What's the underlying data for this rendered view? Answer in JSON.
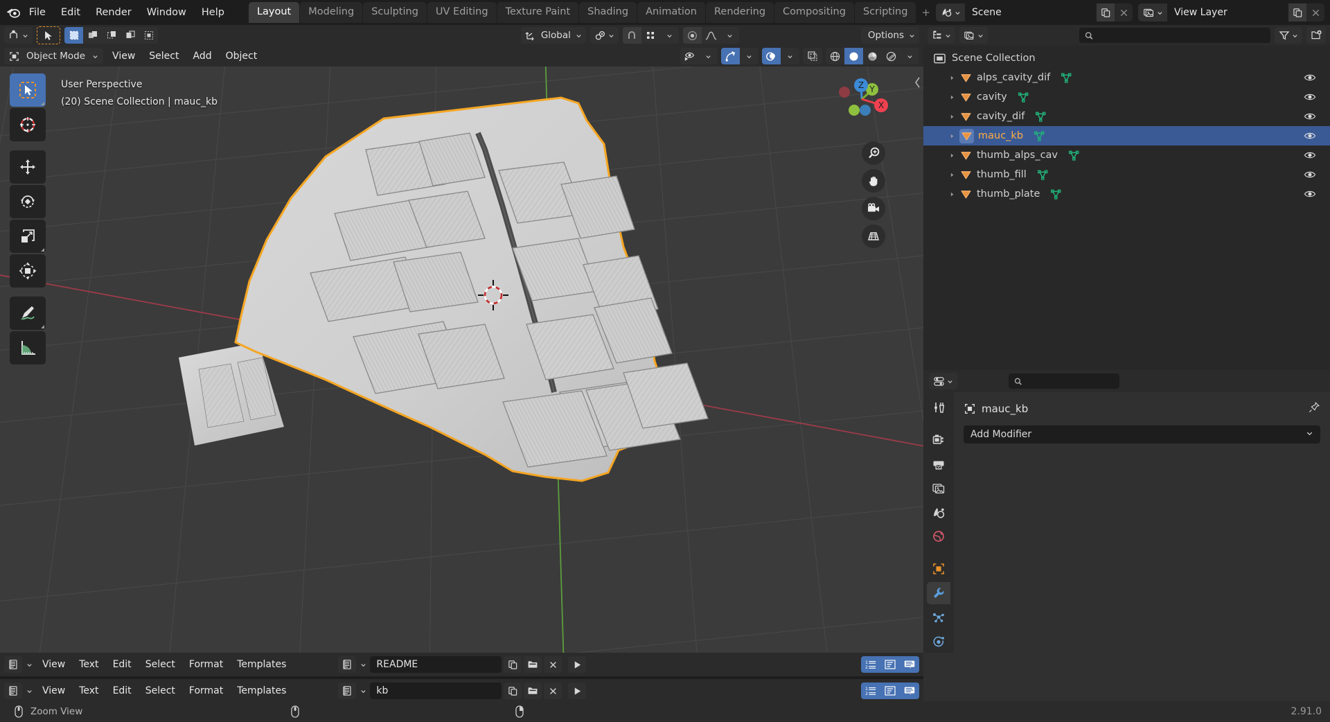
{
  "app": {
    "version": "2.91.0"
  },
  "topbar": {
    "logo_icon": "blender-logo-icon",
    "menus": [
      "File",
      "Edit",
      "Render",
      "Window",
      "Help"
    ],
    "workspaces": [
      {
        "label": "Layout",
        "active": true
      },
      {
        "label": "Modeling",
        "active": false
      },
      {
        "label": "Sculpting",
        "active": false
      },
      {
        "label": "UV Editing",
        "active": false
      },
      {
        "label": "Texture Paint",
        "active": false
      },
      {
        "label": "Shading",
        "active": false
      },
      {
        "label": "Animation",
        "active": false
      },
      {
        "label": "Rendering",
        "active": false
      },
      {
        "label": "Compositing",
        "active": false
      },
      {
        "label": "Scripting",
        "active": false
      }
    ],
    "add_workspace_label": "+",
    "scene": {
      "icon": "scene-icon",
      "name": "Scene",
      "copy_icon": "new-copy-icon",
      "delete_icon": "close-x-icon"
    },
    "view_layer": {
      "icon": "view-layer-icon",
      "name": "View Layer",
      "copy_icon": "new-copy-icon",
      "delete_icon": "close-x-icon"
    }
  },
  "viewport": {
    "header": {
      "editor_type_icon": "editor-type-3dview-icon",
      "cursor_tool_icon": "tweak-select-icon",
      "select_modes": [
        "select-box-icon",
        "select-extend-icon",
        "select-subtract-icon",
        "select-difference-icon",
        "select-intersect-icon"
      ],
      "transform_orientation": "Global",
      "orientation_icon": "orientation-axes-icon",
      "pivot_icon": "pivot-point-icon",
      "snap_icon": "magnet-icon",
      "snap_target_icon": "snap-grid-icon",
      "proportional_icon": "proportional-edit-icon",
      "falloff_icon": "smooth-falloff-icon",
      "options_label": "Options"
    },
    "header2": {
      "mode_icon": "object-mode-icon",
      "mode_label": "Object Mode",
      "menus": [
        "View",
        "Select",
        "Add",
        "Object"
      ],
      "visibility_icon": "visibility-eye-icon",
      "gizmo_icon": "gizmo-icon",
      "overlays_icon": "overlays-icon",
      "xray_icon": "toggle-xray-icon",
      "shading_modes": [
        "shading-wireframe-icon",
        "shading-solid-icon",
        "shading-material-icon",
        "shading-rendered-icon"
      ],
      "shading_active_index": 1
    },
    "overlay_text": {
      "line1": "User Perspective",
      "line2": "(20) Scene Collection | mauc_kb"
    },
    "toolbar": [
      {
        "name": "tool-tweak-select",
        "icon": "cursor-arrow-select-icon",
        "active": true
      },
      {
        "name": "tool-cursor",
        "icon": "3d-cursor-icon",
        "active": false
      },
      {
        "name": "tool-move",
        "icon": "move-arrows-icon",
        "active": false
      },
      {
        "name": "tool-rotate",
        "icon": "rotate-icon",
        "active": false
      },
      {
        "name": "tool-scale",
        "icon": "scale-icon",
        "active": false
      },
      {
        "name": "tool-transform",
        "icon": "transform-icon",
        "active": false
      },
      {
        "name": "tool-annotate",
        "icon": "annotate-pencil-icon",
        "active": false
      },
      {
        "name": "tool-measure",
        "icon": "measure-ruler-icon",
        "active": false
      }
    ],
    "gizmo": {
      "x_label": "X",
      "y_label": "Y",
      "z_label": "Z"
    },
    "nav_buttons": [
      "zoom-magnifier-icon",
      "pan-hand-icon",
      "camera-view-icon",
      "toggle-perspective-icon"
    ],
    "collapse_icon": "chevron-left-icon"
  },
  "outliner": {
    "header": {
      "display_mode_icon": "outliner-display-mode-icon",
      "filter_id_icon": "filter-id-icon",
      "search_placeholder": "",
      "search_icon": "search-icon",
      "filter_icon": "filter-funnel-icon",
      "new_collection_icon": "new-collection-icon"
    },
    "root": {
      "label": "Scene Collection",
      "icon": "collection-icon"
    },
    "items": [
      {
        "label": "alps_cavity_dif",
        "icon": "mesh-object-icon",
        "data_icon": "mesh-data-icon",
        "selected": false,
        "visible_icon": "eye-open-icon"
      },
      {
        "label": "cavity",
        "icon": "mesh-object-icon",
        "data_icon": "mesh-data-icon",
        "selected": false,
        "visible_icon": "eye-open-icon"
      },
      {
        "label": "cavity_dif",
        "icon": "mesh-object-icon",
        "data_icon": "mesh-data-icon",
        "selected": false,
        "visible_icon": "eye-open-icon"
      },
      {
        "label": "mauc_kb",
        "icon": "mesh-object-icon",
        "data_icon": "mesh-data-icon",
        "selected": true,
        "visible_icon": "eye-open-icon"
      },
      {
        "label": "thumb_alps_cav",
        "icon": "mesh-object-icon",
        "data_icon": "mesh-data-icon",
        "selected": false,
        "visible_icon": "eye-open-icon"
      },
      {
        "label": "thumb_fill",
        "icon": "mesh-object-icon",
        "data_icon": "mesh-data-icon",
        "selected": false,
        "visible_icon": "eye-open-icon"
      },
      {
        "label": "thumb_plate",
        "icon": "mesh-object-icon",
        "data_icon": "mesh-data-icon",
        "selected": false,
        "visible_icon": "eye-open-icon"
      }
    ]
  },
  "properties": {
    "header": {
      "editor_type_icon": "properties-editor-icon",
      "search_icon": "search-icon",
      "search_placeholder": ""
    },
    "tabs": [
      {
        "name": "tool",
        "icon": "tool-screwdriver-wrench-icon",
        "active": false
      },
      {
        "name": "render",
        "icon": "render-camera-back-icon",
        "active": false
      },
      {
        "name": "output",
        "icon": "output-printer-icon",
        "active": false
      },
      {
        "name": "view-layer",
        "icon": "view-layer-images-icon",
        "active": false
      },
      {
        "name": "scene",
        "icon": "scene-cone-icon",
        "active": false
      },
      {
        "name": "world",
        "icon": "world-globe-icon",
        "active": false
      },
      {
        "name": "object",
        "icon": "object-square-icon",
        "active": false
      },
      {
        "name": "modifiers",
        "icon": "wrench-icon",
        "active": true
      },
      {
        "name": "particles",
        "icon": "particles-icon",
        "active": false
      },
      {
        "name": "physics",
        "icon": "physics-orbit-icon",
        "active": false
      }
    ],
    "breadcrumb": {
      "icon": "object-square-icon",
      "label": "mauc_kb",
      "pin_icon": "pin-icon"
    },
    "add_modifier": {
      "label": "Add Modifier",
      "chevron_icon": "chevron-down-icon"
    }
  },
  "text_editors": [
    {
      "editor_type_icon": "text-editor-icon",
      "menus": [
        "View",
        "Text",
        "Edit",
        "Select",
        "Format",
        "Templates"
      ],
      "datablock_icon": "text-datablock-icon",
      "filename": "README",
      "new_icon": "new-text-icon",
      "open_icon": "open-folder-icon",
      "unlink_icon": "unlink-x-icon",
      "run_icon": "run-script-play-icon",
      "toggles": [
        "line-numbers-icon",
        "word-wrap-icon",
        "syntax-highlight-icon"
      ]
    },
    {
      "editor_type_icon": "text-editor-icon",
      "menus": [
        "View",
        "Text",
        "Edit",
        "Select",
        "Format",
        "Templates"
      ],
      "datablock_icon": "text-datablock-icon",
      "filename": "kb",
      "new_icon": "new-text-icon",
      "open_icon": "open-folder-icon",
      "unlink_icon": "unlink-x-icon",
      "run_icon": "run-script-play-icon",
      "toggles": [
        "line-numbers-icon",
        "word-wrap-icon",
        "syntax-highlight-icon"
      ]
    }
  ],
  "statusbar": {
    "mouse_icons": [
      "mouse-middle-drag-icon",
      "mouse-middle-icon",
      "mouse-right-icon"
    ],
    "hint": "Zoom View",
    "version": "2.91.0"
  },
  "colors": {
    "accent_blue": "#4772b3",
    "select_orange": "#ffae42",
    "outliner_mesh_orange": "#e7923f",
    "mesh_data_green": "#21b17a",
    "selected_row_blue": "#3a5a96",
    "viewport_bg": "#3b3b3b",
    "panel_bg": "#303030",
    "header_bg": "#2b2b2b",
    "topbar_bg": "#1d1d1d"
  }
}
